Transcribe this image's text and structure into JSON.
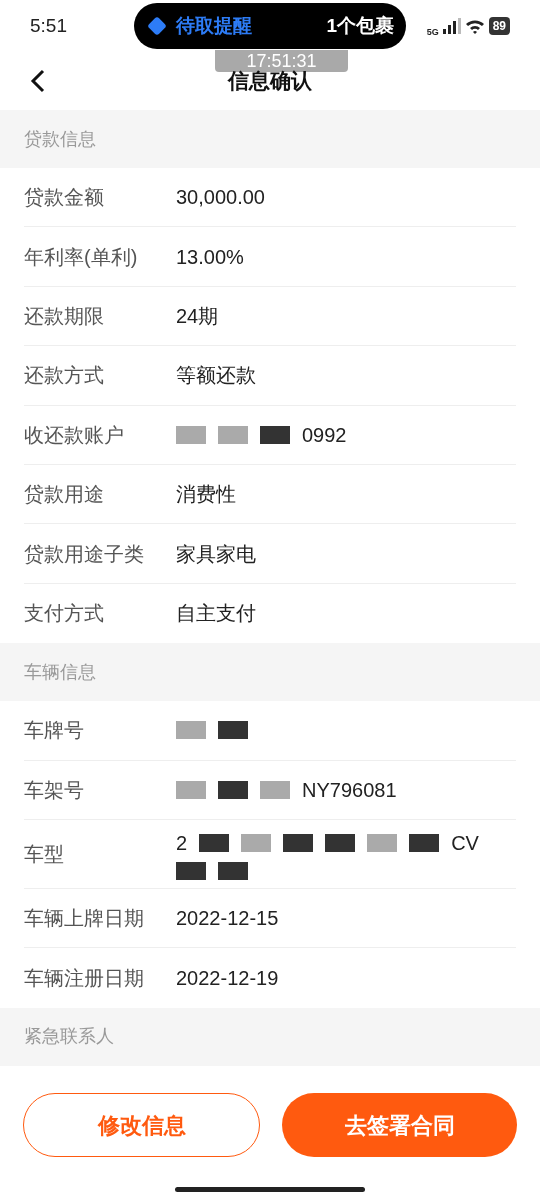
{
  "status_bar": {
    "time": "5:51",
    "notification": {
      "title": "待取提醒",
      "detail": "1个包裹"
    },
    "network": "5G",
    "battery": "89"
  },
  "timestamp": "17:51:31",
  "header": {
    "title": "信息确认"
  },
  "sections": [
    {
      "title": "贷款信息",
      "rows": [
        {
          "label": "贷款金额",
          "value": [
            {
              "kind": "text",
              "text": "30,000.00"
            }
          ]
        },
        {
          "label": "年利率(单利)",
          "value": [
            {
              "kind": "text",
              "text": "13.00%"
            }
          ]
        },
        {
          "label": "还款期限",
          "value": [
            {
              "kind": "text",
              "text": "24期"
            }
          ]
        },
        {
          "label": "还款方式",
          "value": [
            {
              "kind": "text",
              "text": "等额还款"
            }
          ]
        },
        {
          "label": "收还款账户",
          "value": [
            {
              "kind": "mask",
              "dark": false
            },
            {
              "kind": "mask",
              "dark": false
            },
            {
              "kind": "mask",
              "dark": true
            },
            {
              "kind": "text",
              "text": "0992"
            }
          ]
        },
        {
          "label": "贷款用途",
          "value": [
            {
              "kind": "text",
              "text": "消费性"
            }
          ]
        },
        {
          "label": "贷款用途子类",
          "value": [
            {
              "kind": "text",
              "text": "家具家电"
            }
          ]
        },
        {
          "label": "支付方式",
          "value": [
            {
              "kind": "text",
              "text": "自主支付"
            }
          ]
        }
      ]
    },
    {
      "title": "车辆信息",
      "rows": [
        {
          "label": "车牌号",
          "value": [
            {
              "kind": "mask",
              "dark": false
            },
            {
              "kind": "mask",
              "dark": true
            }
          ]
        },
        {
          "label": "车架号",
          "value": [
            {
              "kind": "mask",
              "dark": false
            },
            {
              "kind": "mask",
              "dark": true
            },
            {
              "kind": "mask",
              "dark": false
            },
            {
              "kind": "text",
              "text": "NY796081"
            }
          ]
        },
        {
          "label": "车型",
          "value": [
            {
              "kind": "text",
              "text": "2"
            },
            {
              "kind": "mask",
              "dark": true
            },
            {
              "kind": "mask",
              "dark": false
            },
            {
              "kind": "mask",
              "dark": true
            },
            {
              "kind": "mask",
              "dark": true
            },
            {
              "kind": "mask",
              "dark": false
            },
            {
              "kind": "mask",
              "dark": true
            },
            {
              "kind": "text",
              "text": "CV"
            },
            {
              "kind": "break"
            },
            {
              "kind": "mask",
              "dark": true
            },
            {
              "kind": "mask",
              "dark": true
            }
          ]
        },
        {
          "label": "车辆上牌日期",
          "value": [
            {
              "kind": "text",
              "text": "2022-12-15"
            }
          ]
        },
        {
          "label": "车辆注册日期",
          "value": [
            {
              "kind": "text",
              "text": "2022-12-19"
            }
          ]
        }
      ]
    },
    {
      "title": "紧急联系人"
    }
  ],
  "buttons": [
    {
      "kind": "outline",
      "label": "修改信息"
    },
    {
      "kind": "primary",
      "label": "去签署合同"
    }
  ]
}
